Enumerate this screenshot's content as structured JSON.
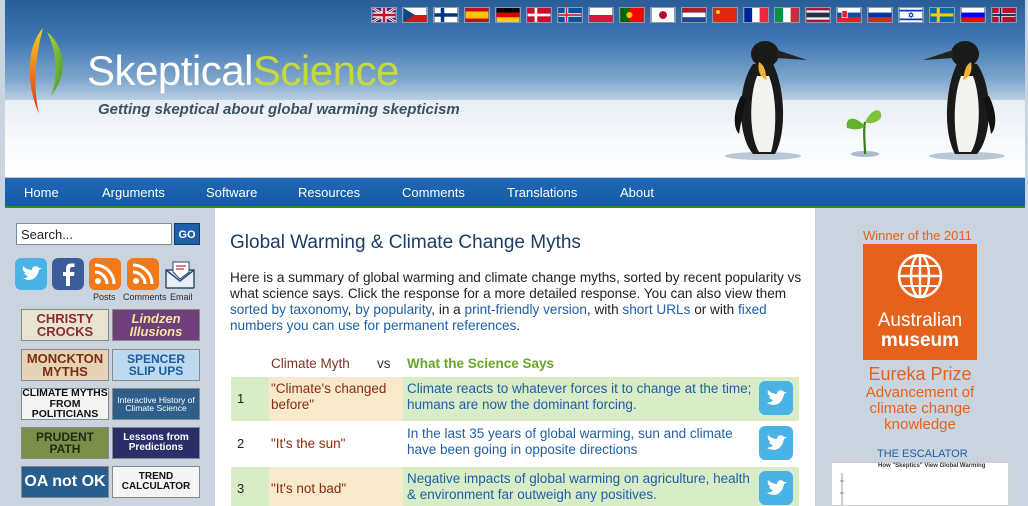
{
  "header": {
    "logo_word1": "Skeptical",
    "logo_word2": "Science",
    "tagline": "Getting skeptical about global warming skepticism",
    "flags": [
      "uk-flag",
      "czech-flag",
      "finnish-flag",
      "spanish-flag",
      "german-flag",
      "danish-flag",
      "icelandic-flag",
      "polish-flag",
      "portuguese-flag",
      "japanese-flag",
      "dutch-flag",
      "chinese-flag",
      "french-flag",
      "italian-flag",
      "thai-flag",
      "slovak-flag",
      "russian-flag",
      "israeli-flag",
      "swedish-flag",
      "slovenian-flag",
      "norwegian-flag"
    ]
  },
  "nav": {
    "items": [
      "Home",
      "Arguments",
      "Software",
      "Resources",
      "Comments",
      "Translations",
      "About"
    ]
  },
  "sidebar": {
    "search_value": "Search...",
    "go_label": "GO",
    "social_labels": [
      "Posts",
      "Comments",
      "Email"
    ],
    "promos": [
      "CHRISTY CROCKS",
      "Lindzen Illusions",
      "MONCKTON MYTHS",
      "SPENCER SLIP UPS",
      "CLIMATE MYTHS FROM POLITICIANS",
      "Interactive History of Climate Science",
      "PRUDENT PATH",
      "Lessons from Predictions",
      "OA not OK",
      "TREND CALCULATOR"
    ]
  },
  "main": {
    "title": "Global Warming & Climate Change Myths",
    "intro": {
      "p1": "Here is a summary of global warming and climate change myths, sorted by recent popularity vs what science says. Click the response for a more detailed response. You can also view them ",
      "link1": "sorted by taxonomy",
      "sep1": ", ",
      "link2": "by popularity",
      "sep2": ", in a ",
      "link3": "print-friendly version",
      "sep3": ", with ",
      "link4": "short URLs",
      "sep4": " or with ",
      "link5": "fixed numbers you can use for permanent references",
      "end": "."
    },
    "table_header": {
      "myth": "Climate Myth",
      "vs": "vs",
      "science": "What the Science Says"
    },
    "rows": [
      {
        "num": "1",
        "myth": "\"Climate's changed before\"",
        "science": "Climate reacts to whatever forces it to change at the time; humans are now the dominant forcing."
      },
      {
        "num": "2",
        "myth": "\"It's the sun\"",
        "science": "In the last 35 years of global warming, sun and climate have been going in opposite directions"
      },
      {
        "num": "3",
        "myth": "\"It's not bad\"",
        "science": "Negative impacts of global warming on agriculture, health & environment far outweigh any positives."
      }
    ]
  },
  "right": {
    "award_top": "Winner of the 2011",
    "award_line1": "Australian",
    "award_line2": "museum",
    "eureka": "Eureka Prize",
    "eureka_sub1": "Advancement of",
    "eureka_sub2": "climate change",
    "eureka_sub3": "knowledge",
    "escalator": "THE ESCALATOR",
    "escalator_caption": "How \"Skeptics\" View Global Warming"
  }
}
